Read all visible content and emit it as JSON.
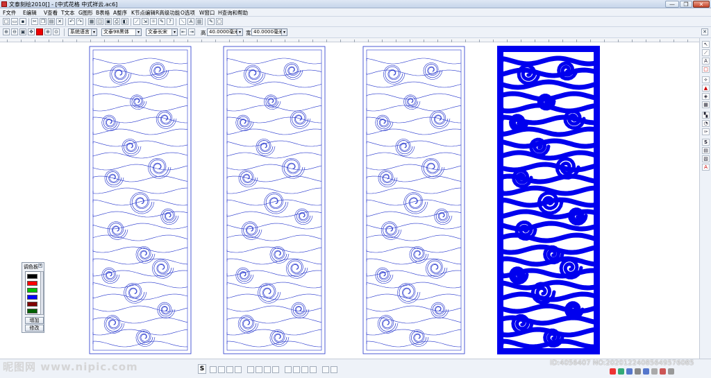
{
  "window": {
    "title": "文泰刻绘2010[] - [中式花格 中式祥云.ac6]",
    "minimize": "—",
    "restore": "❐",
    "close": "✕"
  },
  "menu": [
    "F文件",
    "E编辑",
    "V查看",
    "T文本",
    "G图形",
    "B表格",
    "A整序",
    "K节点编辑",
    "R高级功能",
    "O选项",
    "W窗口",
    "H查询和帮助"
  ],
  "toolbar": {
    "language_combo": "系统语言",
    "font_combo": "文泰98黑体",
    "style_combo": "文泰长宋",
    "height_label": "高",
    "height_value": "40.0000毫米",
    "width_label": "宽",
    "width_value": "40.0000毫米"
  },
  "palette": {
    "title": "调色板",
    "colors": [
      "#000000",
      "#ff0000",
      "#00c000",
      "#0000ff",
      "#800000",
      "#006000"
    ],
    "add_button": "增加",
    "modify_button": "修改"
  },
  "panels": {
    "outline_color": "#2233cc",
    "fill_color": "#0000ee"
  },
  "watermark": {
    "logo": "昵图网 www.nipic.com",
    "id": "ID:4056407 NO:20201224085649576085"
  }
}
